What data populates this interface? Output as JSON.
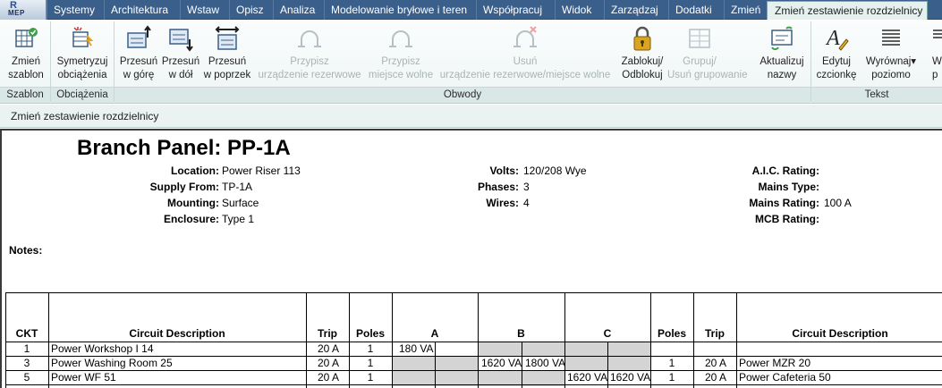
{
  "app": {
    "badge": "MEP"
  },
  "tabs": [
    {
      "label": "Systemy"
    },
    {
      "label": "Architektura"
    },
    {
      "label": "Wstaw"
    },
    {
      "label": "Opisz"
    },
    {
      "label": "Analiza"
    },
    {
      "label": "Modelowanie bryłowe i teren"
    },
    {
      "label": "Współpracuj"
    },
    {
      "label": "Widok"
    },
    {
      "label": "Zarządzaj"
    },
    {
      "label": "Dodatki"
    },
    {
      "label": "Zmień"
    },
    {
      "label": "Zmień zestawienie rozdzielnicy",
      "active": true
    }
  ],
  "ribbon": {
    "buttons": [
      {
        "id": "zmien-szablon",
        "line1": "Zmień",
        "line2": "szablon",
        "icon": "template-icon",
        "enabled": true
      },
      {
        "id": "symetryzuj",
        "line1": "Symetryzuj",
        "line2": "obciążenia",
        "icon": "balance-loads-icon",
        "enabled": true
      },
      {
        "id": "przesun-gore",
        "line1": "Przesuń",
        "line2": "w górę",
        "icon": "move-up-icon",
        "enabled": true
      },
      {
        "id": "przesun-dol",
        "line1": "Przesuń",
        "line2": "w dół",
        "icon": "move-down-icon",
        "enabled": true
      },
      {
        "id": "przesun-poprzek",
        "line1": "Przesuń",
        "line2": "w poprzek",
        "icon": "move-across-icon",
        "enabled": true
      },
      {
        "id": "przypisz-rezerwowe",
        "line1": "Przypisz",
        "line2": "urządzenie rezerwowe",
        "icon": "assign-spare-icon",
        "enabled": false
      },
      {
        "id": "przypisz-wolne",
        "line1": "Przypisz",
        "line2": "miejsce wolne",
        "icon": "assign-space-icon",
        "enabled": false
      },
      {
        "id": "usun",
        "line1": "Usuń",
        "line2": "urządzenie rezerwowe/miejsce wolne",
        "icon": "remove-spare-icon",
        "enabled": false
      },
      {
        "id": "zablokuj",
        "line1": "Zablokuj/",
        "line2": "Odblokuj",
        "icon": "lock-icon",
        "enabled": true
      },
      {
        "id": "grupuj",
        "line1": "Grupuj/",
        "line2": "Usuń grupowanie",
        "icon": "group-icon",
        "enabled": false
      },
      {
        "id": "aktualizuj",
        "line1": "Aktualizuj",
        "line2": "nazwy",
        "icon": "update-names-icon",
        "enabled": true
      },
      {
        "id": "edytuj-czcionke",
        "line1": "Edytuj",
        "line2": "czcionkę",
        "icon": "edit-font-icon",
        "enabled": true
      },
      {
        "id": "wyrownaj",
        "line1": "Wyrównaj",
        "line2": "poziomo",
        "icon": "align-horizontal-icon",
        "enabled": true
      },
      {
        "id": "cut-off",
        "line1": "W",
        "line2": "p",
        "icon": "partial-icon",
        "enabled": true
      }
    ],
    "panels": {
      "szablon": "Szablon",
      "obciazenia": "Obciążenia",
      "obwody": "Obwody",
      "tekst": "Tekst"
    }
  },
  "options_bar": {
    "label": "Zmień zestawienie rozdzielnicy"
  },
  "schedule": {
    "title": "Branch Panel: PP-1A",
    "fields": {
      "location_label": "Location:",
      "location": "Power Riser 113",
      "supply_label": "Supply From:",
      "supply": "TP-1A",
      "mounting_label": "Mounting:",
      "mounting": "Surface",
      "enclosure_label": "Enclosure:",
      "enclosure": "Type 1",
      "volts_label": "Volts:",
      "volts": "120/208 Wye",
      "phases_label": "Phases:",
      "phases": "3",
      "wires_label": "Wires:",
      "wires": "4",
      "aic_label": "A.I.C. Rating:",
      "aic": "",
      "mains_type_label": "Mains Type:",
      "mains_type": "",
      "mains_rating_label": "Mains Rating:",
      "mains_rating": "100 A",
      "mcb_label": "MCB Rating:",
      "mcb": "",
      "notes_label": "Notes:"
    },
    "columns": {
      "ckt": "CKT",
      "desc_left": "Circuit Description",
      "trip_left": "Trip",
      "poles_left": "Poles",
      "a": "A",
      "b": "B",
      "c": "C",
      "poles_right": "Poles",
      "trip_right": "Trip",
      "desc_right": "Circuit Description"
    },
    "rows": [
      {
        "ckt": "1",
        "desc": "Power Workshop I 14",
        "trip": "20 A",
        "poles": "1",
        "a1": "180 VA",
        "a2": "",
        "b1": "",
        "b2": "",
        "c1": "",
        "c2": "",
        "r_poles": "",
        "r_trip": "",
        "r_desc": ""
      },
      {
        "ckt": "3",
        "desc": "Power Washing Room 25",
        "trip": "20 A",
        "poles": "1",
        "a1": "",
        "a2": "",
        "b1": "1620 VA",
        "b2": "1800 VA",
        "c1": "",
        "c2": "",
        "r_poles": "1",
        "r_trip": "20 A",
        "r_desc": "Power MZR 20"
      },
      {
        "ckt": "5",
        "desc": "Power WF 51",
        "trip": "20 A",
        "poles": "1",
        "a1": "",
        "a2": "",
        "b1": "",
        "b2": "",
        "c1": "1620 VA",
        "c2": "1620 VA",
        "r_poles": "1",
        "r_trip": "20 A",
        "r_desc": "Power Cafeteria 50"
      }
    ]
  }
}
